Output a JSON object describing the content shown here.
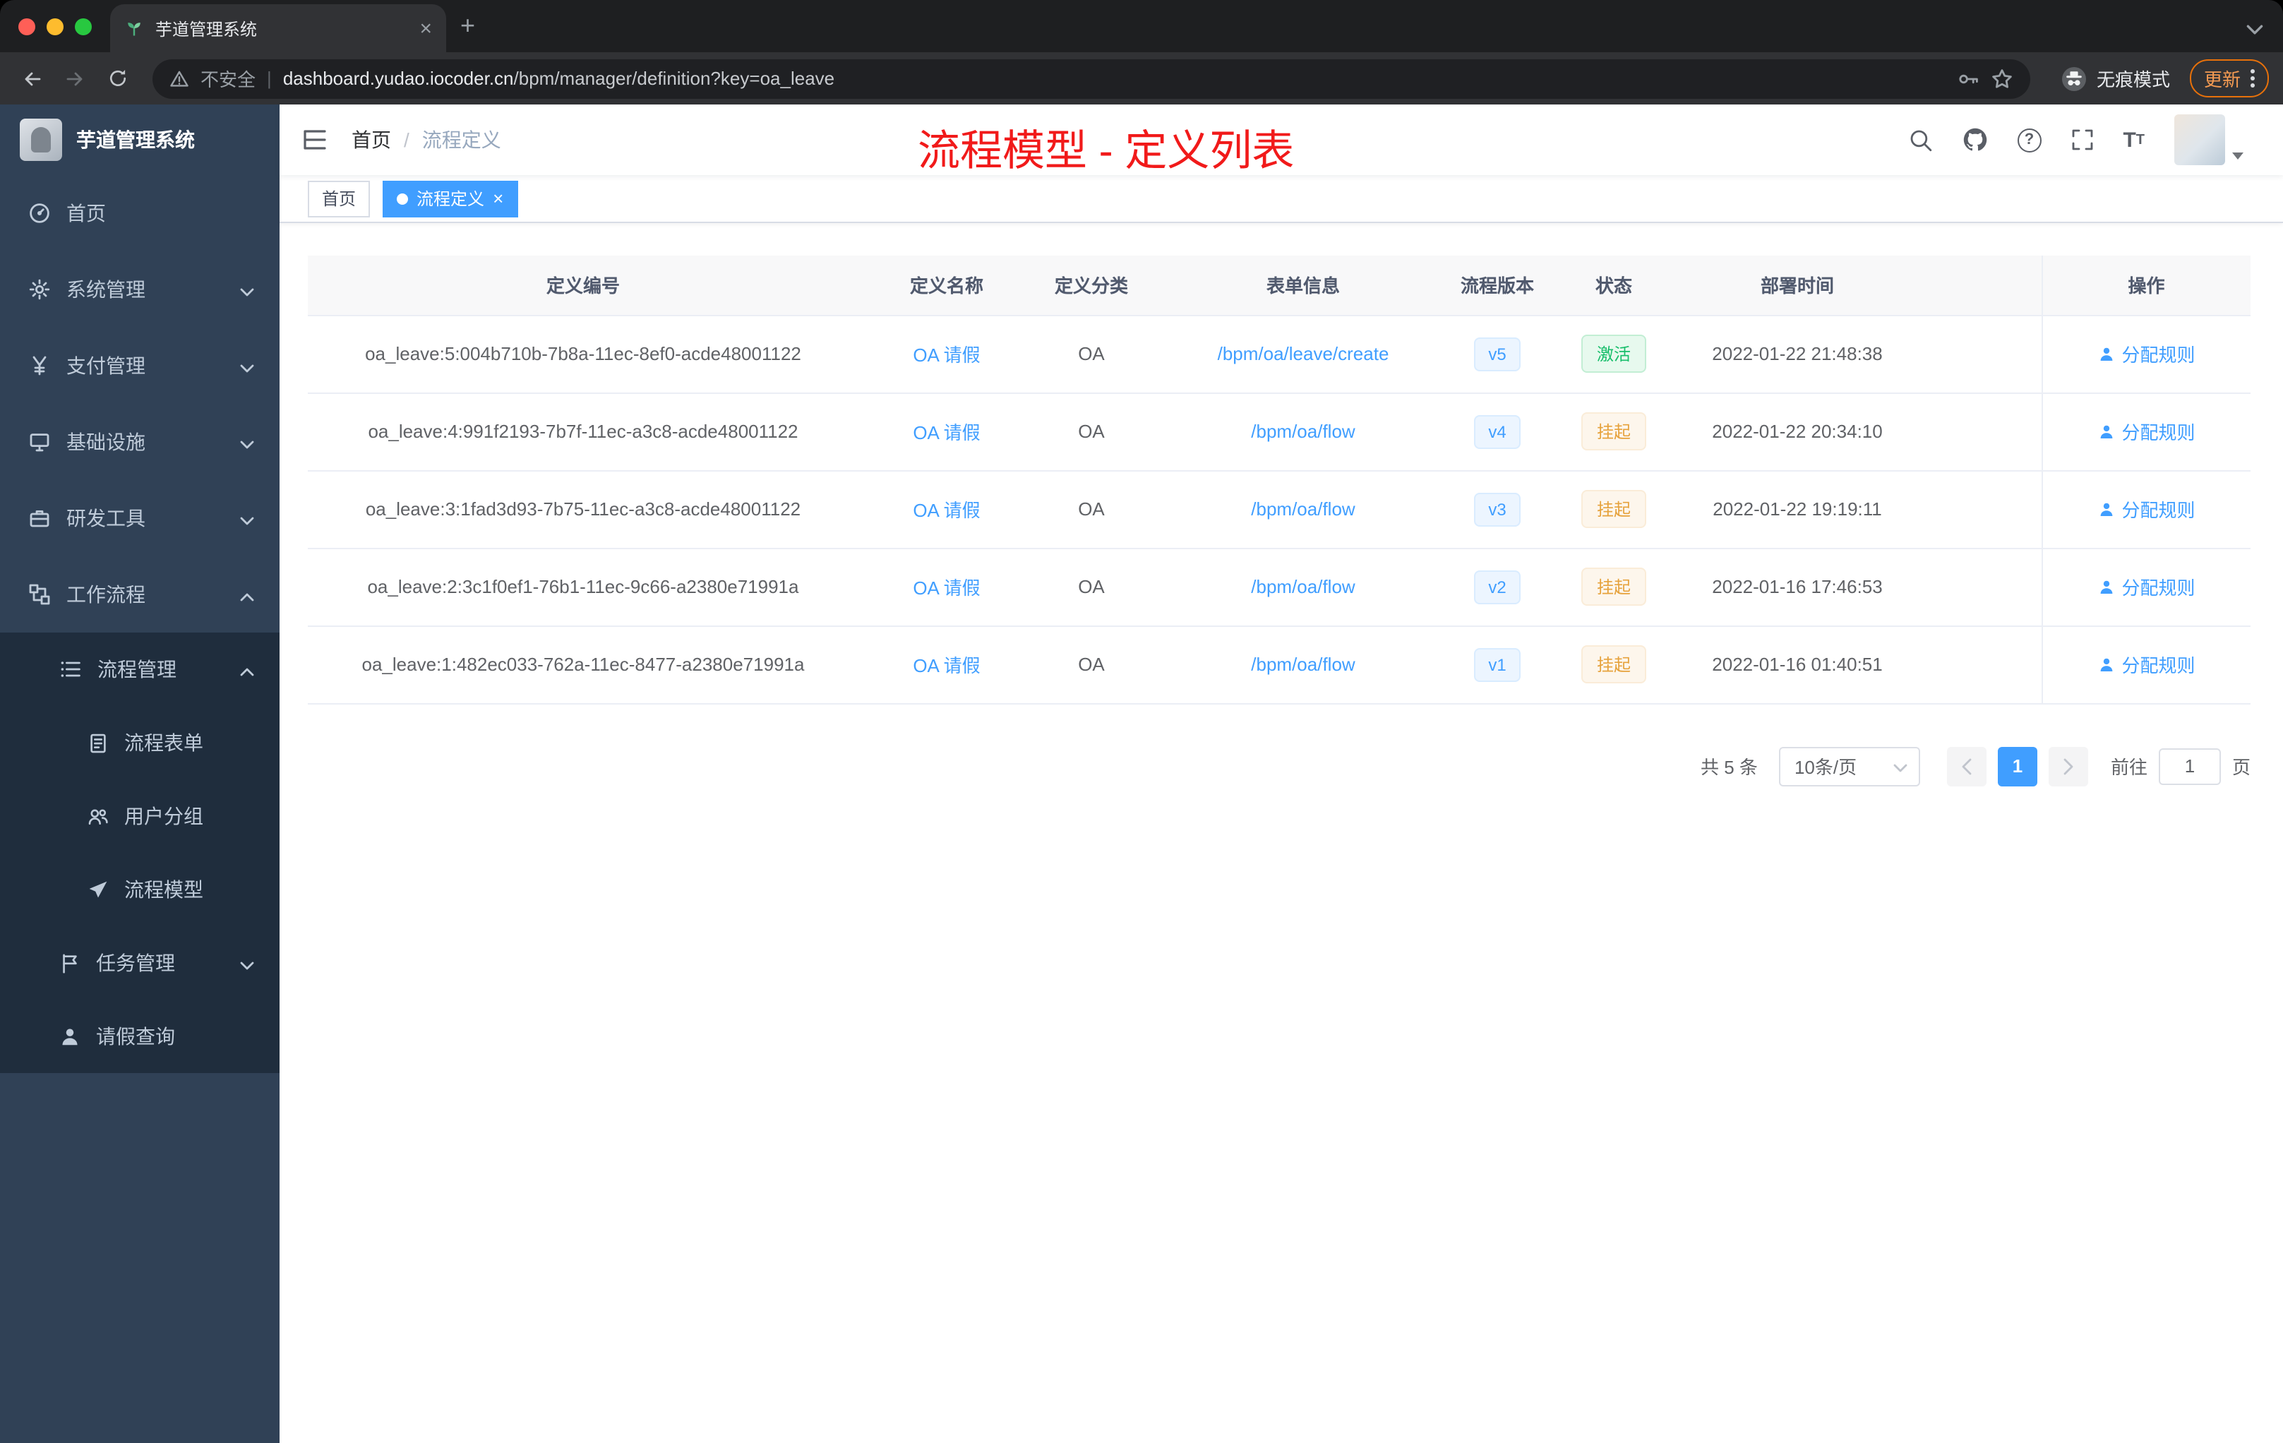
{
  "browser": {
    "tab_title": "芋道管理系统",
    "security_label": "不安全",
    "url_domain": "dashboard.yudao.iocoder.cn",
    "url_path": "/bpm/manager/definition?key=oa_leave",
    "incognito_label": "无痕模式",
    "update_label": "更新"
  },
  "sidebar": {
    "logo_title": "芋道管理系统",
    "menu": {
      "home": "首页",
      "system": "系统管理",
      "payment": "支付管理",
      "infra": "基础设施",
      "devtools": "研发工具",
      "workflow": "工作流程",
      "process_mgmt": "流程管理",
      "process_form": "流程表单",
      "user_group": "用户分组",
      "process_model": "流程模型",
      "task_mgmt": "任务管理",
      "leave_query": "请假查询"
    }
  },
  "header": {
    "breadcrumb_home": "首页",
    "breadcrumb_current": "流程定义",
    "annotation": "流程模型 - 定义列表"
  },
  "tags": {
    "home": "首页",
    "active": "流程定义"
  },
  "table": {
    "headers": [
      "定义编号",
      "定义名称",
      "定义分类",
      "表单信息",
      "流程版本",
      "状态",
      "部署时间",
      "操作"
    ],
    "rows": [
      {
        "id": "oa_leave:5:004b710b-7b8a-11ec-8ef0-acde48001122",
        "name": "OA 请假",
        "category": "OA",
        "form": "/bpm/oa/leave/create",
        "version": "v5",
        "status": {
          "label": "激活",
          "type": "success"
        },
        "deployed": "2022-01-22 21:48:38",
        "action": "分配规则"
      },
      {
        "id": "oa_leave:4:991f2193-7b7f-11ec-a3c8-acde48001122",
        "name": "OA 请假",
        "category": "OA",
        "form": "/bpm/oa/flow",
        "version": "v4",
        "status": {
          "label": "挂起",
          "type": "warning"
        },
        "deployed": "2022-01-22 20:34:10",
        "action": "分配规则"
      },
      {
        "id": "oa_leave:3:1fad3d93-7b75-11ec-a3c8-acde48001122",
        "name": "OA 请假",
        "category": "OA",
        "form": "/bpm/oa/flow",
        "version": "v3",
        "status": {
          "label": "挂起",
          "type": "warning"
        },
        "deployed": "2022-01-22 19:19:11",
        "action": "分配规则"
      },
      {
        "id": "oa_leave:2:3c1f0ef1-76b1-11ec-9c66-a2380e71991a",
        "name": "OA 请假",
        "category": "OA",
        "form": "/bpm/oa/flow",
        "version": "v2",
        "status": {
          "label": "挂起",
          "type": "warning"
        },
        "deployed": "2022-01-16 17:46:53",
        "action": "分配规则"
      },
      {
        "id": "oa_leave:1:482ec033-762a-11ec-8477-a2380e71991a",
        "name": "OA 请假",
        "category": "OA",
        "form": "/bpm/oa/flow",
        "version": "v1",
        "status": {
          "label": "挂起",
          "type": "warning"
        },
        "deployed": "2022-01-16 01:40:51",
        "action": "分配规则"
      }
    ]
  },
  "pagination": {
    "total": "共 5 条",
    "page_size": "10条/页",
    "current_page": "1",
    "goto_label": "前往",
    "goto_value": "1",
    "unit_label": "页"
  },
  "colors": {
    "accent": "#409eff",
    "success_text": "#18be6b",
    "warning_text": "#e6a23c",
    "annotation_red": "#f11a1a",
    "sidebar_bg": "#304156",
    "submenu_bg": "#1f2d3d"
  }
}
